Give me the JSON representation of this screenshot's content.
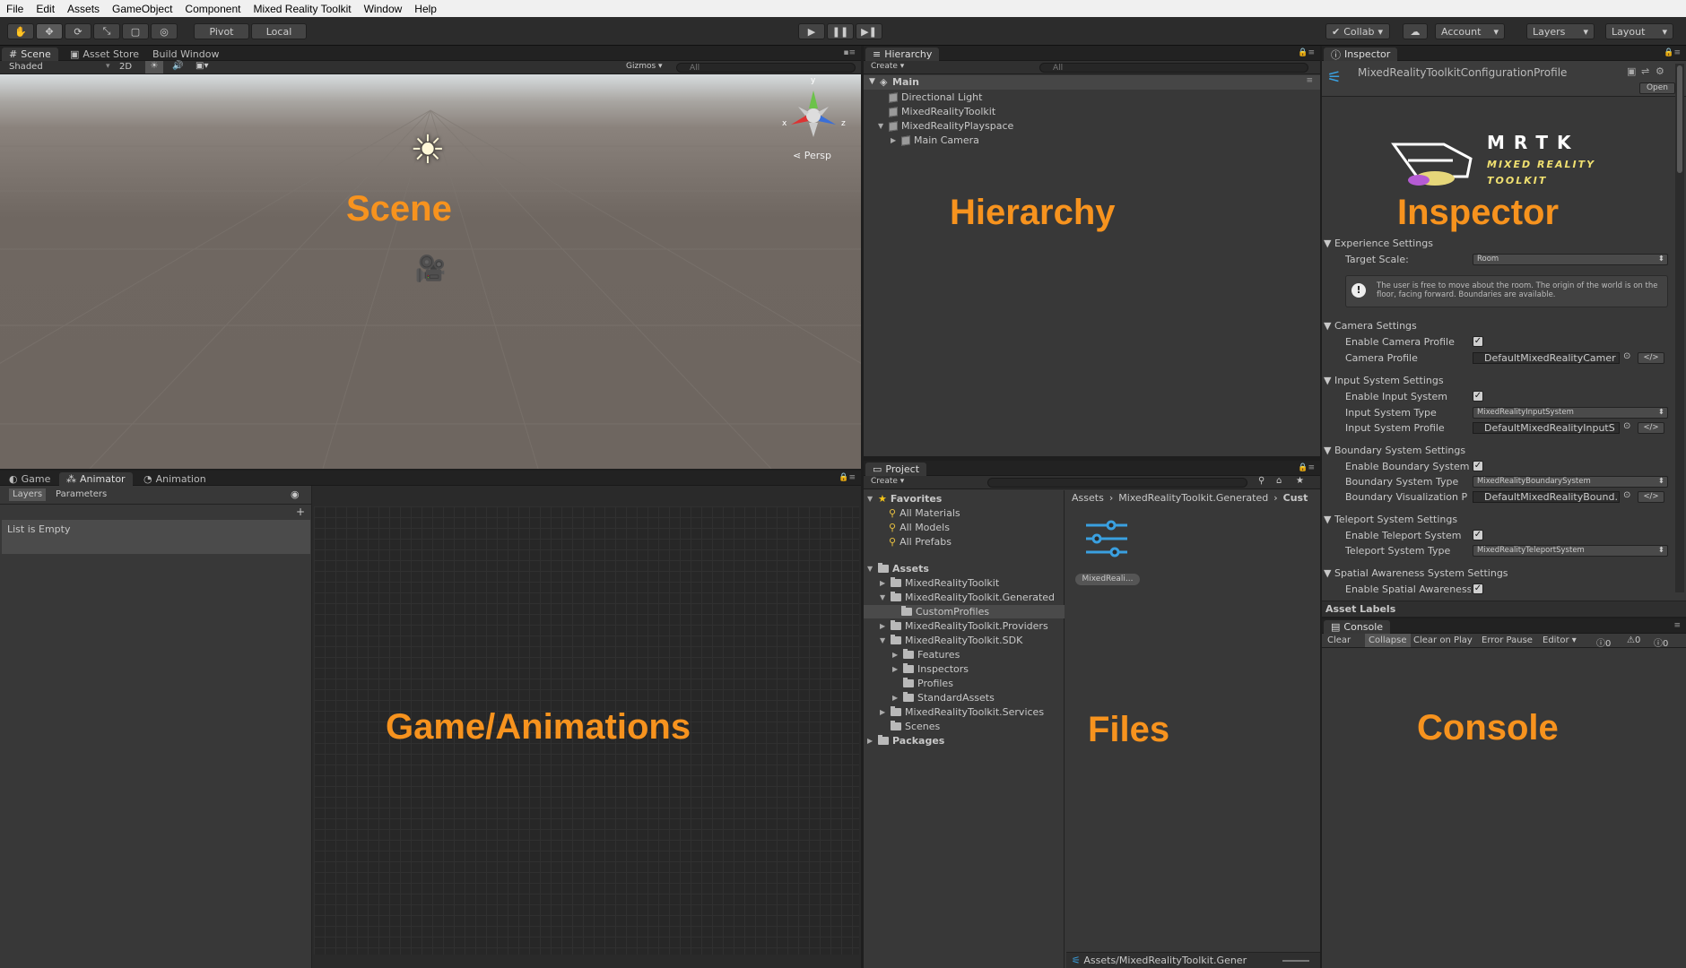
{
  "menu": [
    "File",
    "Edit",
    "Assets",
    "GameObject",
    "Component",
    "Mixed Reality Toolkit",
    "Window",
    "Help"
  ],
  "toolbar": {
    "pivot": "Pivot",
    "local": "Local",
    "collab": "Collab",
    "account": "Account",
    "layers": "Layers",
    "layout": "Layout"
  },
  "scene": {
    "tabs": [
      "Scene",
      "Asset Store",
      "Build Window"
    ],
    "shading": "Shaded",
    "mode2d": "2D",
    "gizmos": "Gizmos",
    "search_placeholder": "All",
    "persp": "Persp",
    "axis_x": "x",
    "axis_y": "y",
    "axis_z": "z",
    "overlay_label": "Scene"
  },
  "hierarchy": {
    "tab": "Hierarchy",
    "create": "Create",
    "search_placeholder": "All",
    "scene_name": "Main",
    "items": [
      "Directional Light",
      "MixedRealityToolkit",
      "MixedRealityPlayspace",
      "Main Camera"
    ],
    "overlay_label": "Hierarchy"
  },
  "inspector": {
    "tab": "Inspector",
    "profile_name": "MixedRealityToolkitConfigurationProfile",
    "open_button": "Open",
    "logo_letters": "MRTK",
    "logo_line1": "MIXED REALITY",
    "logo_line2": "TOOLKIT",
    "overlay_label": "Inspector",
    "sections": {
      "experience": "Experience Settings",
      "target_scale_label": "Target Scale:",
      "target_scale_value": "Room",
      "info": "The user is free to move about the room. The origin of the world is on the floor, facing forward. Boundaries are available.",
      "camera": "Camera Settings",
      "enable_camera": "Enable Camera Profile",
      "camera_profile": "Camera Profile",
      "camera_profile_value": "DefaultMixedRealityCamer",
      "input": "Input System Settings",
      "enable_input": "Enable Input System",
      "input_type": "Input System Type",
      "input_type_value": "MixedRealityInputSystem",
      "input_profile": "Input System Profile",
      "input_profile_value": "DefaultMixedRealityInputS",
      "boundary": "Boundary System Settings",
      "enable_boundary": "Enable Boundary System",
      "boundary_type": "Boundary System Type",
      "boundary_type_value": "MixedRealityBoundarySystem",
      "boundary_vis": "Boundary Visualization P",
      "boundary_vis_value": "DefaultMixedRealityBound.",
      "teleport": "Teleport System Settings",
      "enable_teleport": "Enable Teleport System",
      "teleport_type": "Teleport System Type",
      "teleport_type_value": "MixedRealityTeleportSystem",
      "spatial": "Spatial Awareness System Settings",
      "enable_spatial": "Enable Spatial Awareness"
    },
    "asset_labels": "Asset Labels",
    "code_glyph": "</>"
  },
  "game": {
    "tabs": [
      "Game",
      "Animator",
      "Animation"
    ],
    "layers": "Layers",
    "parameters": "Parameters",
    "list_empty": "List is Empty",
    "overlay_label": "Game/Animations"
  },
  "project": {
    "tab": "Project",
    "create": "Create",
    "favorites": "Favorites",
    "fav_items": [
      "All Materials",
      "All Models",
      "All Prefabs"
    ],
    "assets": "Assets",
    "tree": [
      "MixedRealityToolkit",
      "MixedRealityToolkit.Generated",
      "CustomProfiles",
      "MixedRealityToolkit.Providers",
      "MixedRealityToolkit.SDK",
      "Features",
      "Inspectors",
      "Profiles",
      "StandardAssets",
      "MixedRealityToolkit.Services",
      "Scenes"
    ],
    "packages": "Packages",
    "breadcrumb": [
      "Assets",
      "MixedRealityToolkit.Generated",
      "Cust"
    ],
    "file_label": "MixedReali...",
    "footer_path": "Assets/MixedRealityToolkit.Gener",
    "overlay_label": "Files"
  },
  "console": {
    "tab": "Console",
    "buttons": [
      "Clear",
      "Collapse",
      "Clear on Play",
      "Error Pause",
      "Editor"
    ],
    "counts": [
      "0",
      "0",
      "0"
    ],
    "overlay_label": "Console"
  },
  "colors": {
    "accent": "#f7931e",
    "sky": "#cfd6d8",
    "ground": "#6e6660",
    "dark": "#2b2b2b"
  }
}
